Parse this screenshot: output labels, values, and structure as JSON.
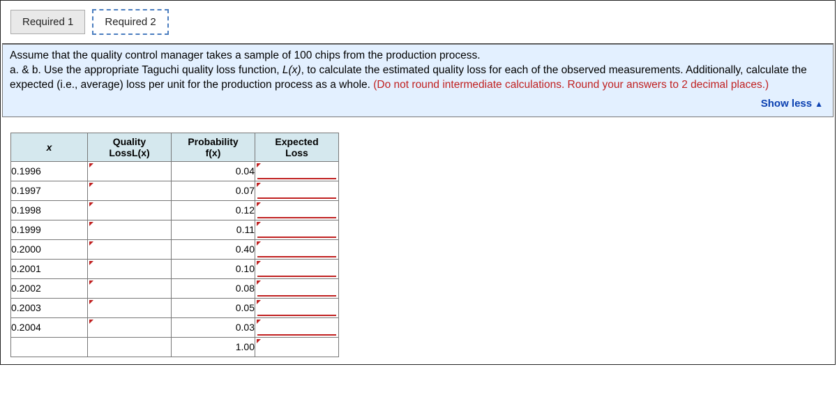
{
  "tabs": {
    "required1": "Required 1",
    "required2": "Required 2"
  },
  "prompt": {
    "line1": "Assume that the quality control manager takes a sample of 100 chips from the production process.",
    "line2a": "a. & b. Use the appropriate Taguchi quality loss function, ",
    "line2_lx": "L(x)",
    "line2b": ", to calculate the estimated quality loss for each of the observed measurements. Additionally, calculate the expected (i.e., average) loss per unit for the production process as a whole. ",
    "hint": "(Do not round intermediate calculations. Round your answers to 2 decimal places.)"
  },
  "show_less_label": "Show less",
  "headers": {
    "x": "x",
    "quality_a": "Quality",
    "quality_b": "LossL(x)",
    "prob_a": "Probability",
    "prob_b": "f(x)",
    "expected_a": "Expected",
    "expected_b": "Loss"
  },
  "rows": [
    {
      "x": "0.1996",
      "p": "0.04"
    },
    {
      "x": "0.1997",
      "p": "0.07"
    },
    {
      "x": "0.1998",
      "p": "0.12"
    },
    {
      "x": "0.1999",
      "p": "0.11"
    },
    {
      "x": "0.2000",
      "p": "0.40"
    },
    {
      "x": "0.2001",
      "p": "0.10"
    },
    {
      "x": "0.2002",
      "p": "0.08"
    },
    {
      "x": "0.2003",
      "p": "0.05"
    },
    {
      "x": "0.2004",
      "p": "0.03"
    }
  ],
  "total_p": "1.00"
}
